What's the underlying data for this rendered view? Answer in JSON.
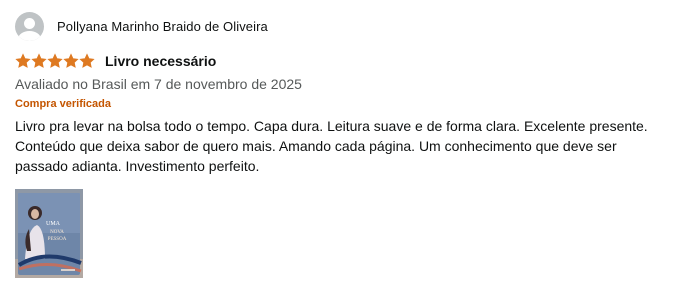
{
  "reviewer": {
    "name": "Pollyana Marinho Braido de Oliveira",
    "avatar_icon": "user-avatar-icon"
  },
  "review": {
    "rating": 5,
    "rating_max": 5,
    "star_color": "#de7921",
    "title": "Livro necessário",
    "date_text": "Avaliado no Brasil em 7 de novembro de 2025",
    "verified_label": "Compra verificada",
    "verified_color": "#c45500",
    "body": "Livro pra levar na bolsa todo o tempo. Capa dura. Leitura suave e de forma clara. Excelente presente. Conteúdo que deixa sabor de quero mais. Amando cada página. Um conhecimento que deve ser passado adianta. Investimento perfeito."
  }
}
